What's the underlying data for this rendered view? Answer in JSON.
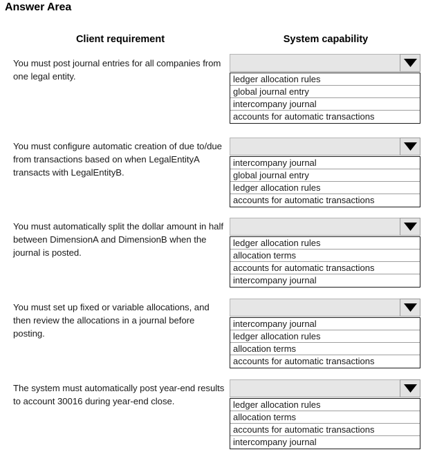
{
  "page": {
    "title": "Answer Area"
  },
  "headers": {
    "client_requirement": "Client requirement",
    "system_capability": "System capability"
  },
  "icons": {
    "dropdown_arrow": "chevron-down-icon"
  },
  "colors": {
    "select_background": "#e6e6e6",
    "select_border": "#b4b4b4",
    "list_border": "#1b1b1b",
    "option_separator": "#9e9e9e",
    "text": "#1a1a1a",
    "page_background": "#ffffff"
  },
  "rows": [
    {
      "requirement": "You must post journal entries for all companies from one legal entity.",
      "dropdown": {
        "selected": "",
        "placeholder": "",
        "options": [
          "ledger allocation rules",
          "global journal entry",
          "intercompany journal",
          "accounts for automatic transactions"
        ]
      }
    },
    {
      "requirement": "You must configure automatic creation of due to/due from transactions based on when LegalEntityA transacts with LegalEntityB.",
      "dropdown": {
        "selected": "",
        "placeholder": "",
        "options": [
          "intercompany journal",
          "global journal entry",
          "ledger allocation rules",
          "accounts for automatic transactions"
        ]
      }
    },
    {
      "requirement": "You must automatically split the dollar amount in half between DimensionA and DimensionB when the journal is posted.",
      "dropdown": {
        "selected": "",
        "placeholder": "",
        "options": [
          "ledger allocation rules",
          "allocation terms",
          "accounts for automatic transactions",
          "intercompany journal"
        ]
      }
    },
    {
      "requirement": "You must set up fixed or variable allocations, and then review the allocations in a journal before posting.",
      "dropdown": {
        "selected": "",
        "placeholder": "",
        "options": [
          "intercompany journal",
          "ledger allocation rules",
          "allocation terms",
          "accounts for automatic transactions"
        ]
      }
    },
    {
      "requirement": "The system must automatically post year-end results to account 30016 during year-end close.",
      "dropdown": {
        "selected": "",
        "placeholder": "",
        "options": [
          "ledger allocation rules",
          "allocation terms",
          "accounts for automatic transactions",
          "intercompany journal"
        ]
      }
    }
  ],
  "layout": {
    "row_tops": [
      78,
      199,
      315,
      432,
      549
    ],
    "req_tops": [
      82,
      202,
      318,
      435,
      552
    ]
  }
}
